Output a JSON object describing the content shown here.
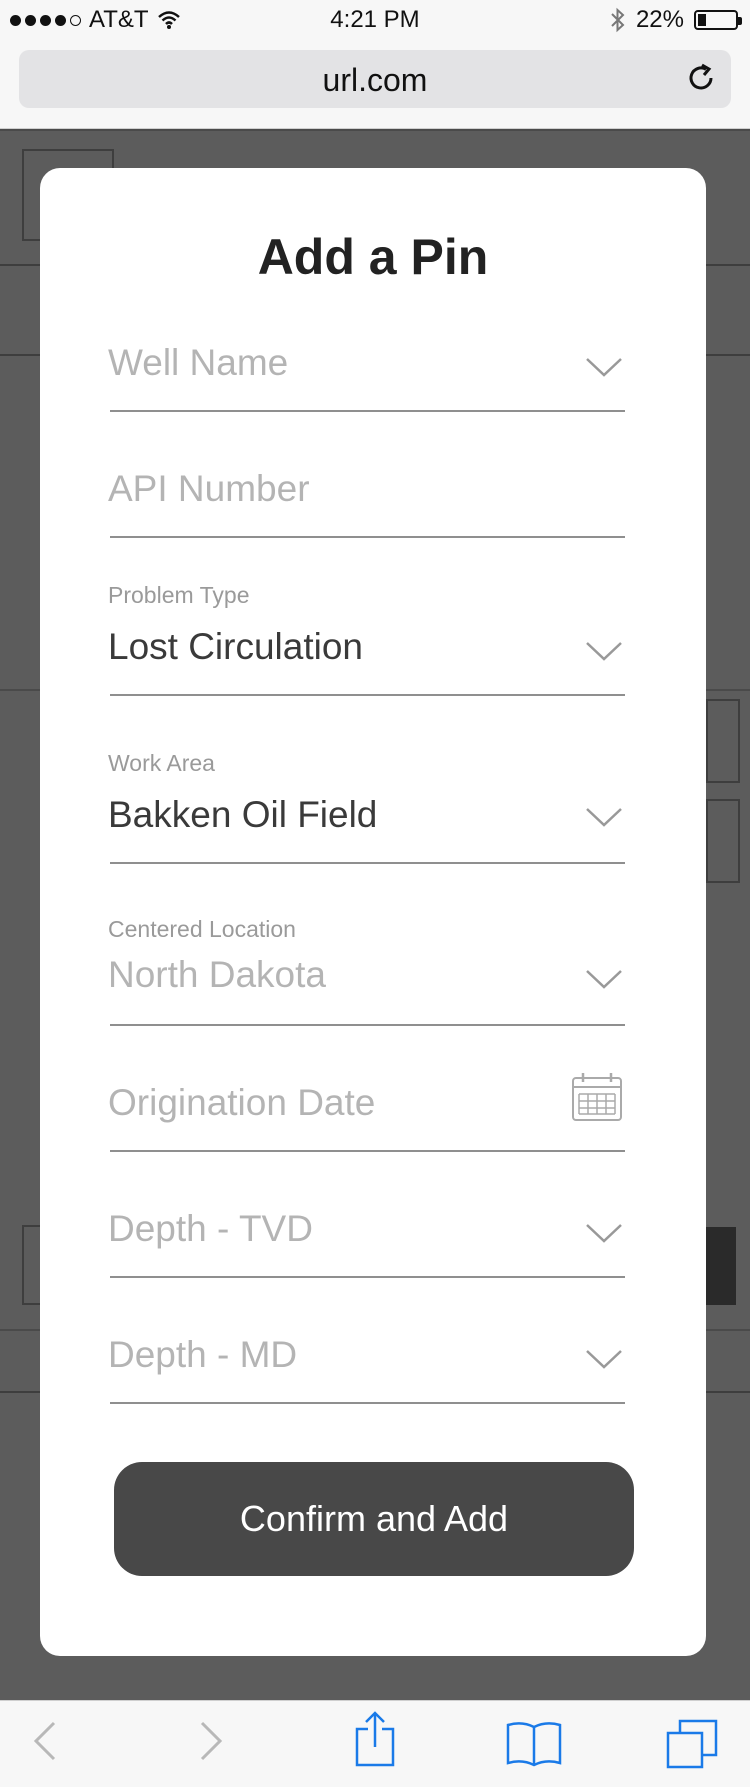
{
  "status_bar": {
    "carrier": "AT&T",
    "time": "4:21 PM",
    "battery": "22%",
    "battery_level": 0.22
  },
  "browser": {
    "url": "url.com"
  },
  "modal": {
    "title": "Add a Pin",
    "fields": [
      {
        "label": "",
        "value": "Well Name",
        "placeholder": true,
        "control": "dropdown"
      },
      {
        "label": "",
        "value": "API Number",
        "placeholder": true,
        "control": "text"
      },
      {
        "label": "Problem Type",
        "value": "Lost Circulation",
        "placeholder": false,
        "control": "dropdown"
      },
      {
        "label": "Work Area",
        "value": "Bakken Oil Field",
        "placeholder": false,
        "control": "dropdown"
      },
      {
        "label": "Centered Location",
        "value": "North Dakota",
        "placeholder": true,
        "control": "dropdown"
      },
      {
        "label": "",
        "value": "Origination Date",
        "placeholder": true,
        "control": "date"
      },
      {
        "label": "",
        "value": "Depth - TVD",
        "placeholder": true,
        "control": "dropdown"
      },
      {
        "label": "",
        "value": "Depth - MD",
        "placeholder": true,
        "control": "dropdown"
      }
    ],
    "confirm_label": "Confirm and Add"
  },
  "icons": {
    "signal": "signal-dots-icon",
    "wifi": "wifi-icon",
    "bluetooth": "bluetooth-icon",
    "battery": "battery-icon",
    "reload": "reload-icon",
    "chevron": "chevron-down-icon",
    "calendar": "calendar-icon",
    "back": "back-arrow-icon",
    "forward": "forward-arrow-icon",
    "share": "share-icon",
    "bookmarks": "bookmarks-icon",
    "tabs": "tabs-icon"
  },
  "colors": {
    "button": "#484848",
    "overlay": "#5c5c5c",
    "toolbar_icons": "#1a7ae8"
  }
}
